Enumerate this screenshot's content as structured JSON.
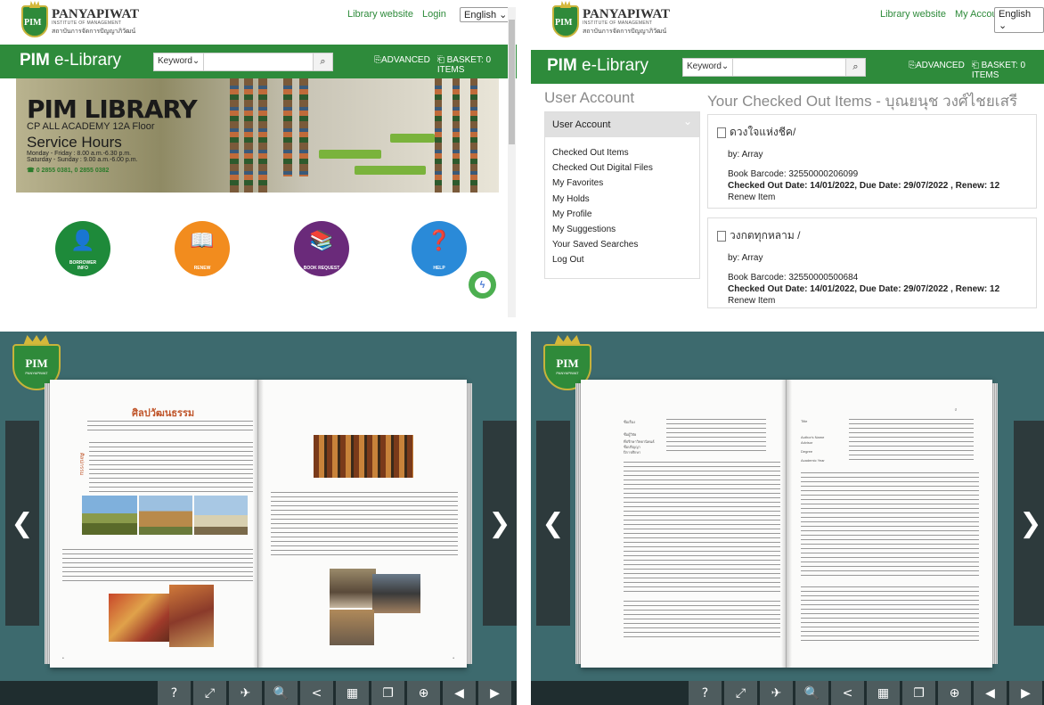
{
  "q1": {
    "logo": {
      "line1": "PANYAPIWAT",
      "line2": "INSTITUTE OF MANAGEMENT",
      "line3": "สถาบันการจัดการปัญญาภิวัฒน์",
      "badge": "PIM"
    },
    "toplinks": [
      "Library website",
      "Login"
    ],
    "language": "English",
    "brand": {
      "bold": "PIM",
      "rest": " e-Library"
    },
    "search": {
      "category": "Keyword",
      "button_icon": "search-icon"
    },
    "nav": [
      "ADVANCED",
      "BASKET: 0 ITEMS"
    ],
    "banner": {
      "title": "PIM LIBRARY",
      "floor": "CP ALL ACADEMY 12A Floor",
      "hours_title": "Service Hours",
      "weekday": "Monday - Friday : 8.00 a.m.-6.30 p.m.",
      "weekend": "Saturday - Sunday : 9.00 a.m.-6.00 p.m.",
      "phone": "0 2855 0381, 0 2855 0382"
    },
    "services": [
      {
        "label": "BORROWER INFO",
        "color": "#1e8a3a",
        "icon": "person-icon"
      },
      {
        "label": "RENEW",
        "color": "#f28c1e",
        "icon": "renew-icon"
      },
      {
        "label": "BOOK REQUEST",
        "color": "#6a2a7a",
        "icon": "book-request-icon"
      },
      {
        "label": "HELP",
        "color": "#2a8ad8",
        "icon": "help-icon"
      }
    ],
    "chat_icon": "messenger-icon"
  },
  "q2": {
    "logo": {
      "line1": "PANYAPIWAT",
      "line2": "INSTITUTE OF MANAGEMENT",
      "line3": "สถาบันการจัดการปัญญาภิวัฒน์",
      "badge": "PIM"
    },
    "toplinks": [
      "Library website",
      "My Account"
    ],
    "language": "English",
    "brand": {
      "bold": "PIM",
      "rest": " e-Library"
    },
    "search": {
      "category": "Keyword"
    },
    "nav": [
      "ADVANCED",
      "BASKET: 0 ITEMS"
    ],
    "account_heading": "User Account",
    "checked_heading": "Your Checked Out Items - บุณยนุช วงศ์ไชยเสรี",
    "sidebar": {
      "header": "User Account",
      "items": [
        "Checked Out Items",
        "Checked Out Digital Files",
        "My Favorites",
        "My Holds",
        "My Profile",
        "My Suggestions",
        "Your Saved Searches",
        "Log Out"
      ]
    },
    "items": [
      {
        "title": "ดวงใจแห่งชีค/",
        "by": "by: Array",
        "barcode": "Book Barcode: 32550000206099",
        "dates": "Checked Out Date: 14/01/2022, Due Date: 29/07/2022 , Renew: 12",
        "renew": "Renew Item"
      },
      {
        "title": "วงกตทุกหลาม /",
        "by": "by: Array",
        "barcode": "Book Barcode: 32550000500684",
        "dates": "Checked Out Date: 14/01/2022, Due Date: 29/07/2022 , Renew: 12",
        "renew": "Renew Item"
      }
    ]
  },
  "q3": {
    "logo": {
      "badge": "PIM",
      "sub": "PANYAPIWAT"
    },
    "page_title": "ศิลปวัฒนธรรม",
    "side_label": "ศิลปกรรม",
    "toolbar": [
      "?",
      "⤢",
      "✈",
      "🔍",
      "<",
      "▦",
      "❐",
      "⊕",
      "◀",
      "▶"
    ]
  },
  "q4": {
    "logo": {
      "badge": "PIM",
      "sub": "PANYAPIWAT"
    },
    "right_labels": [
      "Title",
      "Author's Name",
      "Advisor",
      "Degree",
      "Academic Year"
    ],
    "left_labels": [
      "ชื่อเรื่อง",
      "ชื่อผู้วิจัย",
      "ที่ปรึกษาวิทยานิพนธ์",
      "ชื่อปริญญา",
      "ปีการศึกษา"
    ],
    "toolbar": [
      "?",
      "⤢",
      "✈",
      "🔍",
      "<",
      "▦",
      "❐",
      "⊕",
      "◀",
      "▶"
    ]
  }
}
